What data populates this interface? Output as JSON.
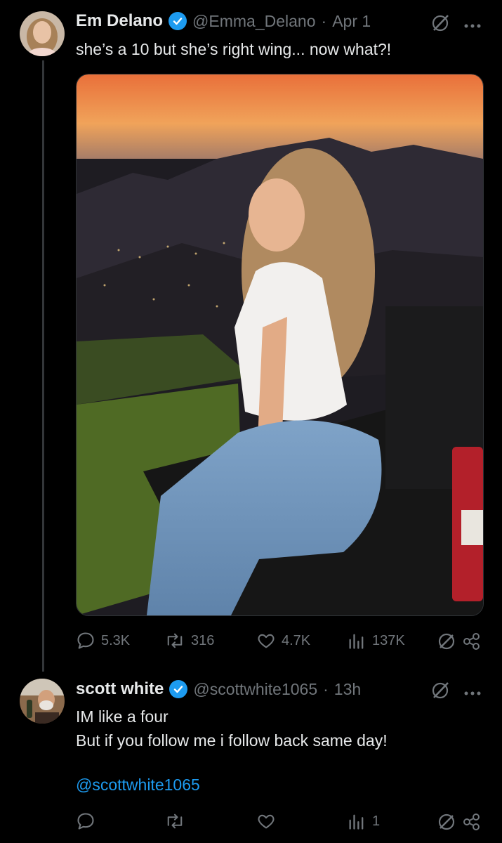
{
  "tweet": {
    "author_name": "Em Delano",
    "handle": "@Emma_Delano",
    "separator": "·",
    "time": "Apr 1",
    "text": "she’s a 10 but she’s right wing... now what?!",
    "stats": {
      "replies": "5.3K",
      "reposts": "316",
      "likes": "4.7K",
      "views": "137K"
    }
  },
  "reply": {
    "author_name": "scott white",
    "handle": "@scottwhite1065",
    "separator": "·",
    "time": "13h",
    "line1": "IM like a four",
    "line2": "But if you follow me i follow back same day!",
    "mention": "@scottwhite1065",
    "stats": {
      "views": "1"
    }
  },
  "colors": {
    "accent": "#1d9bf0",
    "muted": "#71767b",
    "text": "#e7e9ea",
    "background": "#000000"
  }
}
